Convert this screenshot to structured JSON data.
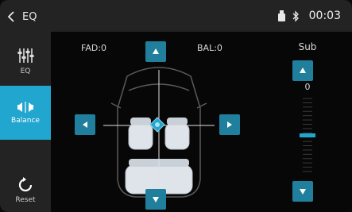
{
  "header": {
    "title": "EQ",
    "clock": "00:03"
  },
  "sidebar": {
    "items": [
      {
        "label": "EQ",
        "icon": "sliders-icon"
      },
      {
        "label": "Balance",
        "icon": "speaker-balance-icon",
        "active": true
      },
      {
        "label": "Reset",
        "icon": "reset-icon"
      }
    ]
  },
  "balance": {
    "fad_label": "FAD:0",
    "bal_label": "BAL:0"
  },
  "sub": {
    "label": "Sub",
    "value": "0",
    "level": 0.5
  },
  "colors": {
    "accent": "#21a6cf",
    "button": "#1f7f9c",
    "bar": "#232323"
  }
}
